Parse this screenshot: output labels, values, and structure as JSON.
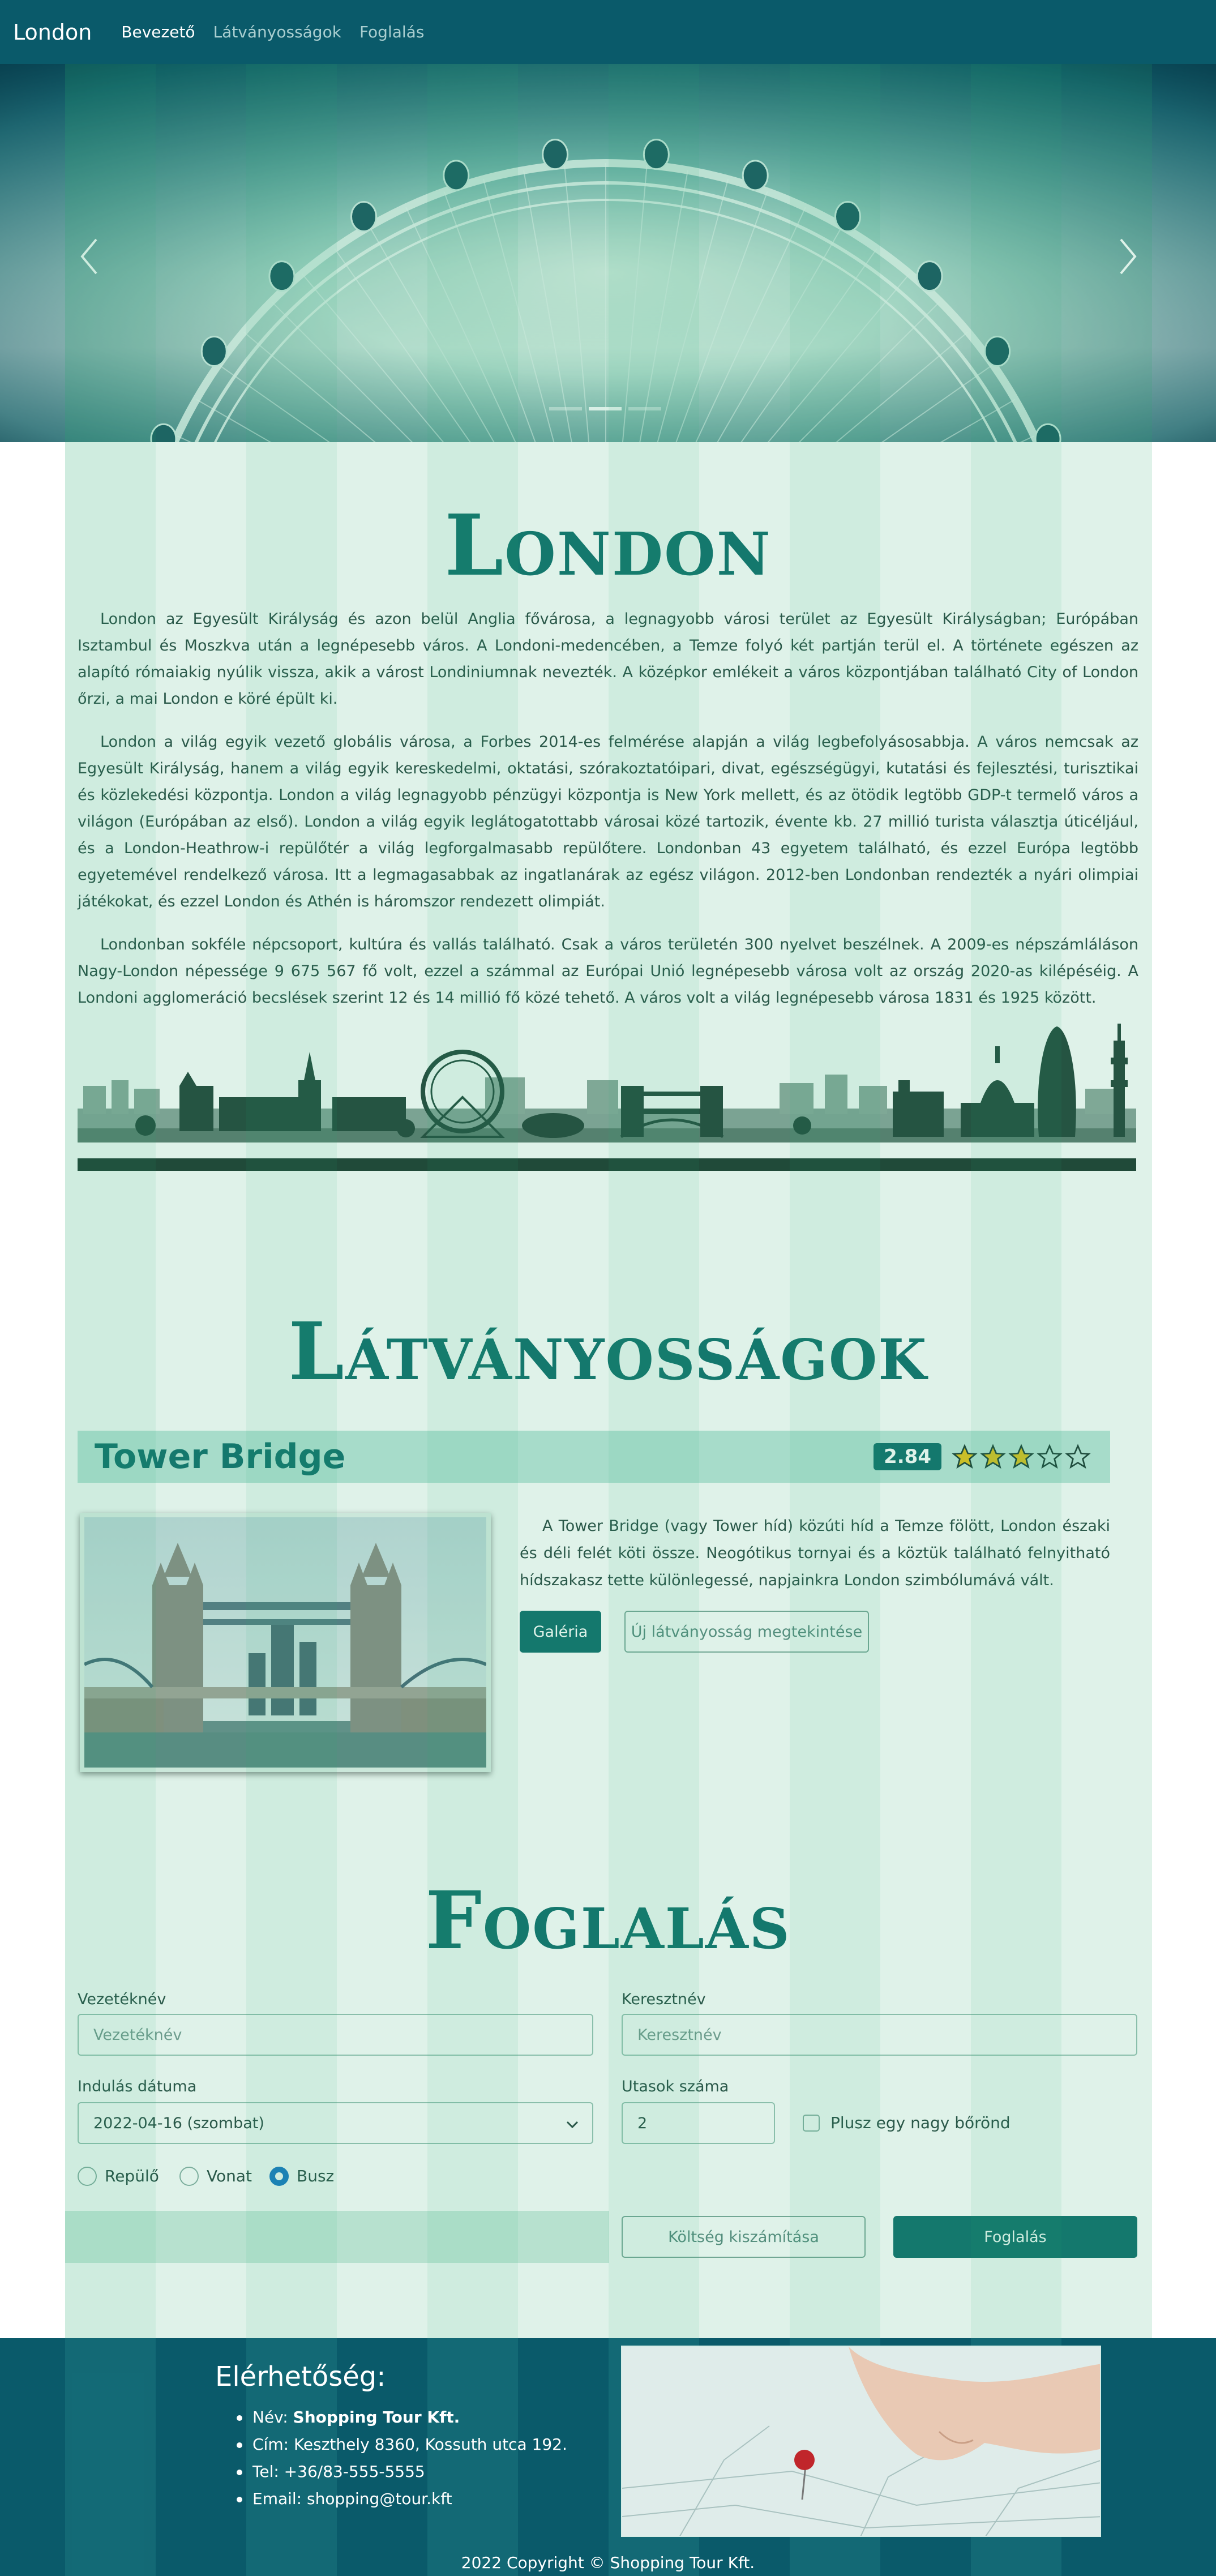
{
  "navbar": {
    "brand": "London",
    "links": [
      "Bevezető",
      "Látványosságok",
      "Foglalás"
    ]
  },
  "grid_columns": [
    "1",
    "2",
    "3",
    "4",
    "5",
    "6",
    "7",
    "8",
    "9",
    "10",
    "11",
    "12"
  ],
  "hero": {
    "slide_count": 3,
    "active_slide": 2
  },
  "intro": {
    "title": "London",
    "paragraphs": [
      "London az Egyesült Királyság és azon belül Anglia fővárosa, a legnagyobb városi terület az Egyesült Királyságban; Európában Isztambul és Moszkva után a legnépesebb város. A Londoni-medencében, a Temze folyó két partján terül el. A története egészen az alapító rómaiakig nyúlik vissza, akik a várost Londiniumnak nevezték. A középkor emlékeit a város központjában található City of London őrzi, a mai London e köré épült ki.",
      "London a világ egyik vezető globális városa, a Forbes 2014-es felmérése alapján a világ legbefolyásosabbja. A város nemcsak az Egyesült Királyság, hanem a világ egyik kereskedelmi, oktatási, szórakoztatóipari, divat, egészségügyi, kutatási és fejlesztési, turisztikai és közlekedési központja. London a világ legnagyobb pénzügyi központja is New York mellett, és az ötödik legtöbb GDP-t termelő város a világon (Európában az első). London a világ egyik leglátogatottabb városai közé tartozik, évente kb. 27 millió turista választja úticéljául, és a London-Heathrow-i repülőtér a világ legforgalmasabb repülőtere. Londonban 43 egyetem található, és ezzel Európa legtöbb egyetemével rendelkező városa. Itt a legmagasabbak az ingatlanárak az egész világon. 2012-ben Londonban rendezték a nyári olimpiai játékokat, és ezzel London és Athén is háromszor rendezett olimpiát.",
      "Londonban sokféle népcsoport, kultúra és vallás található. Csak a város területén 300 nyelvet beszélnek. A 2009-es népszámláláson Nagy-London népessége 9 675 567 fő volt, ezzel a számmal az Európai Unió legnépesebb városa volt az ország 2020-as kilépéséig. A Londoni agglomeráció becslések szerint 12 és 14 millió fő közé tehető. A város volt a világ legnépesebb városa 1831 és 1925 között."
    ]
  },
  "sights": {
    "title": "Látványosságok",
    "item": {
      "name": "Tower Bridge",
      "rating": "2.84",
      "rating_value": 2.84,
      "rating_max": 5,
      "description": "A Tower Bridge (vagy Tower híd) közúti híd a Temze fölött, London északi és déli felét köti össze. Neogótikus tornyai és a köztük található felnyitható hídszakasz tette különlegessé, napjainkra London szimbólumává vált.",
      "gallery_label": "Galéria",
      "visit_label": "Új látványosság megtekintése"
    }
  },
  "booking": {
    "title": "Foglalás",
    "last_name_label": "Vezetéknév",
    "last_name_placeholder": "Vezetéknév",
    "first_name_label": "Keresztnév",
    "first_name_placeholder": "Keresztnév",
    "date_label": "Indulás dátuma",
    "date_value": "2022-04-16 (szombat)",
    "passengers_label": "Utasok száma",
    "passengers_value": "2",
    "luggage_label": "Plusz egy nagy bőrönd",
    "transport_options": [
      "Repülő",
      "Vonat",
      "Busz"
    ],
    "transport_selected": "Busz",
    "cost_button": "Költség kiszámítása",
    "book_button": "Foglalás"
  },
  "footer": {
    "contact_title": "Elérhetőség:",
    "name_label": "Név: ",
    "name_value": "Shopping Tour Kft.",
    "address": "Cím: Keszthely 8360, Kossuth utca 192.",
    "phone": "Tel: +36/83-555-5555",
    "email": "Email: shopping@tour.kft",
    "copyright": "2022 Copyright © Shopping Tour Kft."
  },
  "colors": {
    "primary": "#11706e",
    "navbar": "#0a5a6a",
    "grid_overlay": "#26aa6e",
    "radio_checked": "#1a78c8",
    "star_fill": "#e8c31e"
  }
}
